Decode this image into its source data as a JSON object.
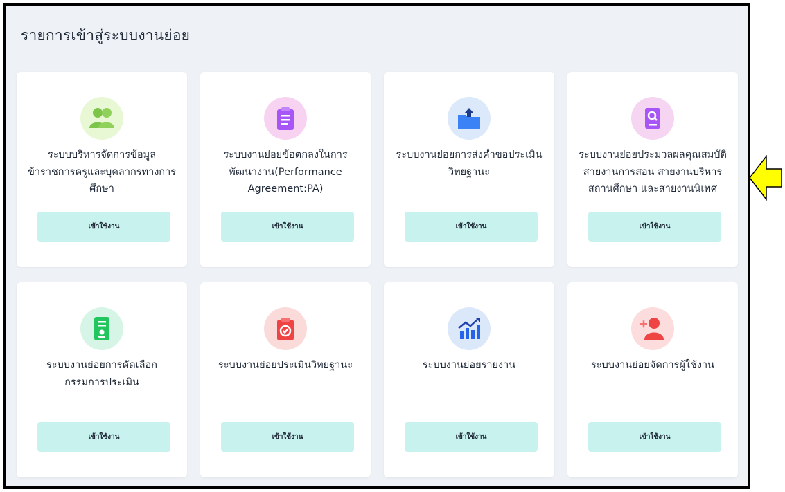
{
  "page": {
    "title": "รายการเข้าสู่ระบบงานย่อย",
    "button_label": "เข้าใช้งาน"
  },
  "cards": [
    {
      "title": "ระบบบริหารจัดการข้อมูลข้าราชการครูและบุคลากรทางการศึกษา",
      "icon": "users-icon",
      "icon_color": "#7cc54a",
      "icon_bg": "#e9f8d4"
    },
    {
      "title": "ระบบงานย่อยข้อตกลงในการพัฒนางาน(Performance Agreement:PA)",
      "icon": "clipboard-icon",
      "icon_color": "#a855f7",
      "icon_bg": "#f7d3f1"
    },
    {
      "title": "ระบบงานย่อยการส่งคำขอประเมินวิทยฐานะ",
      "icon": "upload-folder-icon",
      "icon_color": "#3b82f6",
      "icon_bg": "#dbe9fb"
    },
    {
      "title": "ระบบงานย่อยประมวลผลคุณสมบัติสายงานการสอน สายงานบริหารสถานศึกษา และสายงานนิเทศ",
      "icon": "document-search-icon",
      "icon_color": "#a855f7",
      "icon_bg": "#f6d5f2"
    },
    {
      "title": "ระบบงานย่อยการคัดเลือกกรรมการประเมิน",
      "icon": "id-badge-icon",
      "icon_color": "#22c55e",
      "icon_bg": "#d6f5e6"
    },
    {
      "title": "ระบบงานย่อยประเมินวิทยฐานะ",
      "icon": "clipboard-check-icon",
      "icon_color": "#ef4444",
      "icon_bg": "#fbdada"
    },
    {
      "title": "ระบบงานย่อยรายงาน",
      "icon": "chart-growth-icon",
      "icon_color": "#2563eb",
      "icon_bg": "#dbe8fa"
    },
    {
      "title": "ระบบงานย่อยจัดการผู้ใช้งาน",
      "icon": "add-user-icon",
      "icon_color": "#ef4444",
      "icon_bg": "#fcdcdc"
    }
  ],
  "colors": {
    "button_bg": "#c8f2ee",
    "arrow_fill": "#ffff00",
    "frame_border": "#000000"
  }
}
